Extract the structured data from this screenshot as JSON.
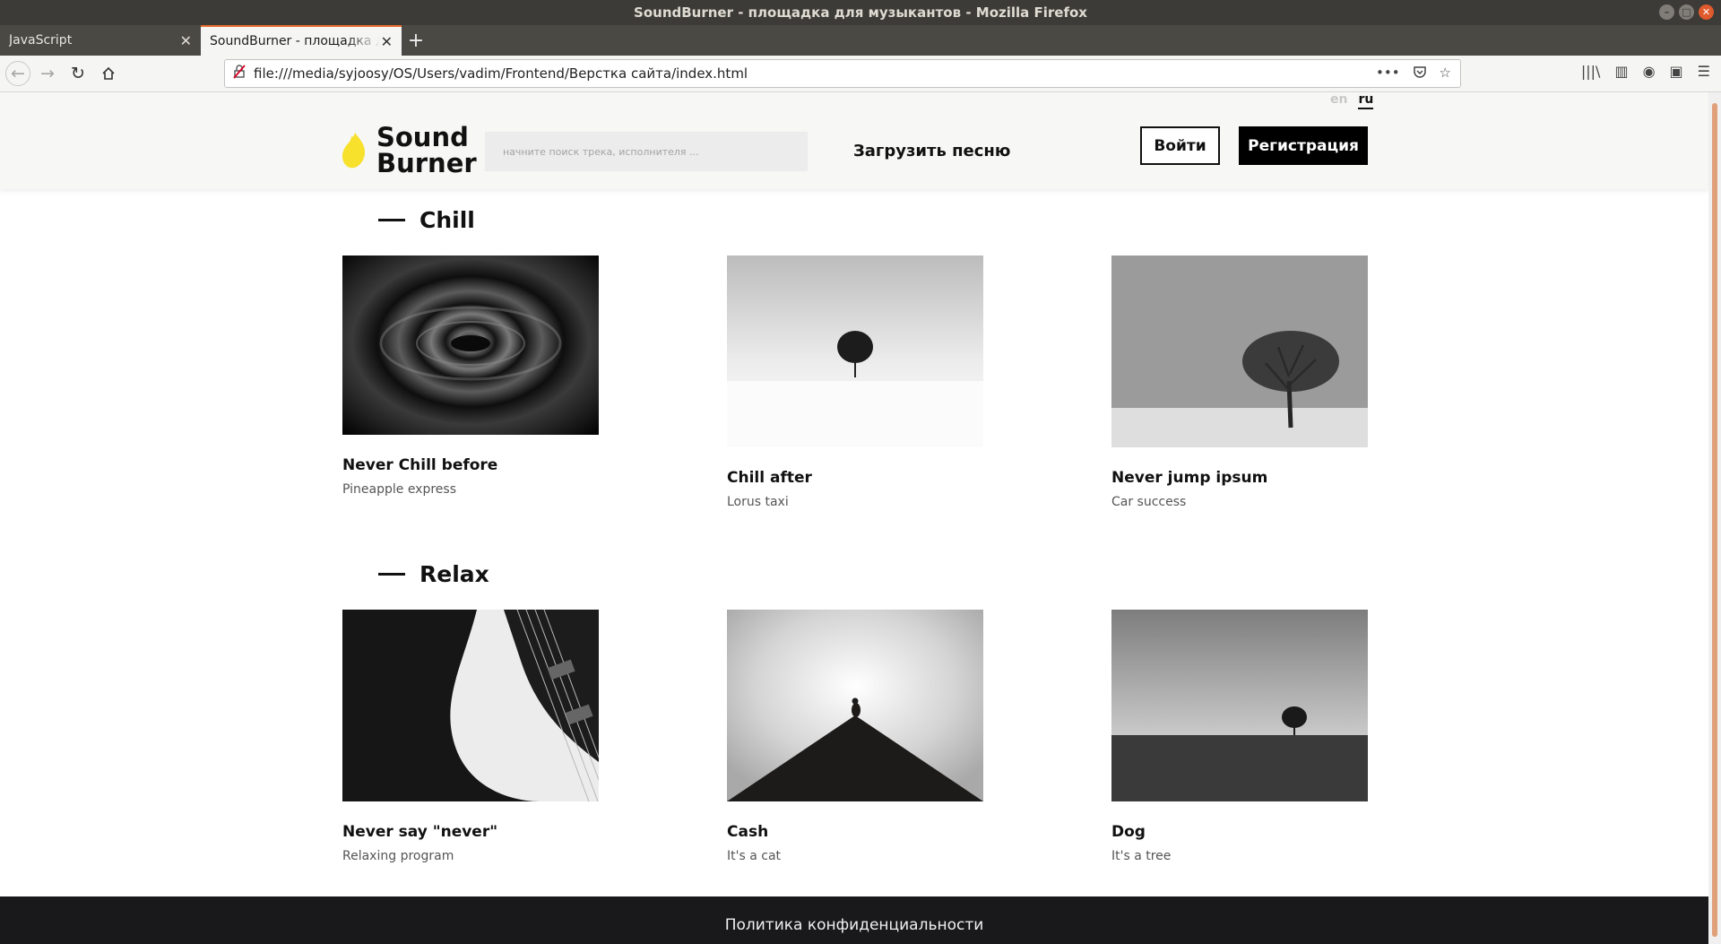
{
  "window": {
    "title": "SoundBurner - площадка для музыкантов - Mozilla Firefox"
  },
  "tabs": [
    {
      "label": "JavaScript",
      "active": false
    },
    {
      "label": "SoundBurner - площадка для музыкантов",
      "active": true
    }
  ],
  "navbar": {
    "url": "file:///media/syjoosy/OS/Users/vadim/Frontend/Верстка сайта/index.html"
  },
  "site": {
    "lang": {
      "en": "en",
      "ru": "ru",
      "active": "ru"
    },
    "logo": {
      "line1": "Sound",
      "line2": "Burner",
      "flame_color": "#f7e12d"
    },
    "search_placeholder": "начните поиск трека, исполнителя ...",
    "upload_label": "Загрузить песню",
    "login_label": "Войти",
    "register_label": "Регистрация"
  },
  "sections": [
    {
      "title": "Chill",
      "cards": [
        {
          "title": "Never Chill before",
          "subtitle": "Pineapple express",
          "image": "water-ripple"
        },
        {
          "title": "Chill after",
          "subtitle": "Lorus taxi",
          "image": "tree-snow-bright"
        },
        {
          "title": "Never jump ipsum",
          "subtitle": "Car success",
          "image": "tree-snow-grey"
        }
      ]
    },
    {
      "title": "Relax",
      "cards": [
        {
          "title": "Never say \"never\"",
          "subtitle": "Relaxing program",
          "image": "guitar"
        },
        {
          "title": "Cash",
          "subtitle": "It's a cat",
          "image": "cat-on-roof"
        },
        {
          "title": "Dog",
          "subtitle": "It's a tree",
          "image": "tree-field"
        }
      ]
    }
  ],
  "footer": {
    "link": "Политика конфиденциальности"
  },
  "colors": {
    "accent_tab": "#e66b2a",
    "footer_bg": "#19191b",
    "button_dark": "#000000"
  }
}
